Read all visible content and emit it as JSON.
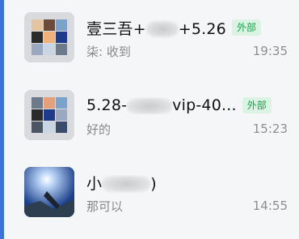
{
  "chats": [
    {
      "title": "壹三吾+",
      "title_tail": "+5.26",
      "tag": "外部",
      "preview": "柒: 收到",
      "time": "19:35",
      "avatar": "group-avatar"
    },
    {
      "title": "5.28-",
      "title_tail": "vip-40...",
      "tag": "外部",
      "preview": "好的",
      "time": "15:23",
      "avatar": "group-avatar"
    },
    {
      "title": "小",
      "title_tail": ")",
      "tag": "",
      "preview": "那可以",
      "time": "14:55",
      "avatar": "photo-avatar"
    }
  ],
  "colors": {
    "accent": "#3b73d6",
    "tag_text": "#16a34a",
    "tag_bg": "#dcf3e4"
  }
}
